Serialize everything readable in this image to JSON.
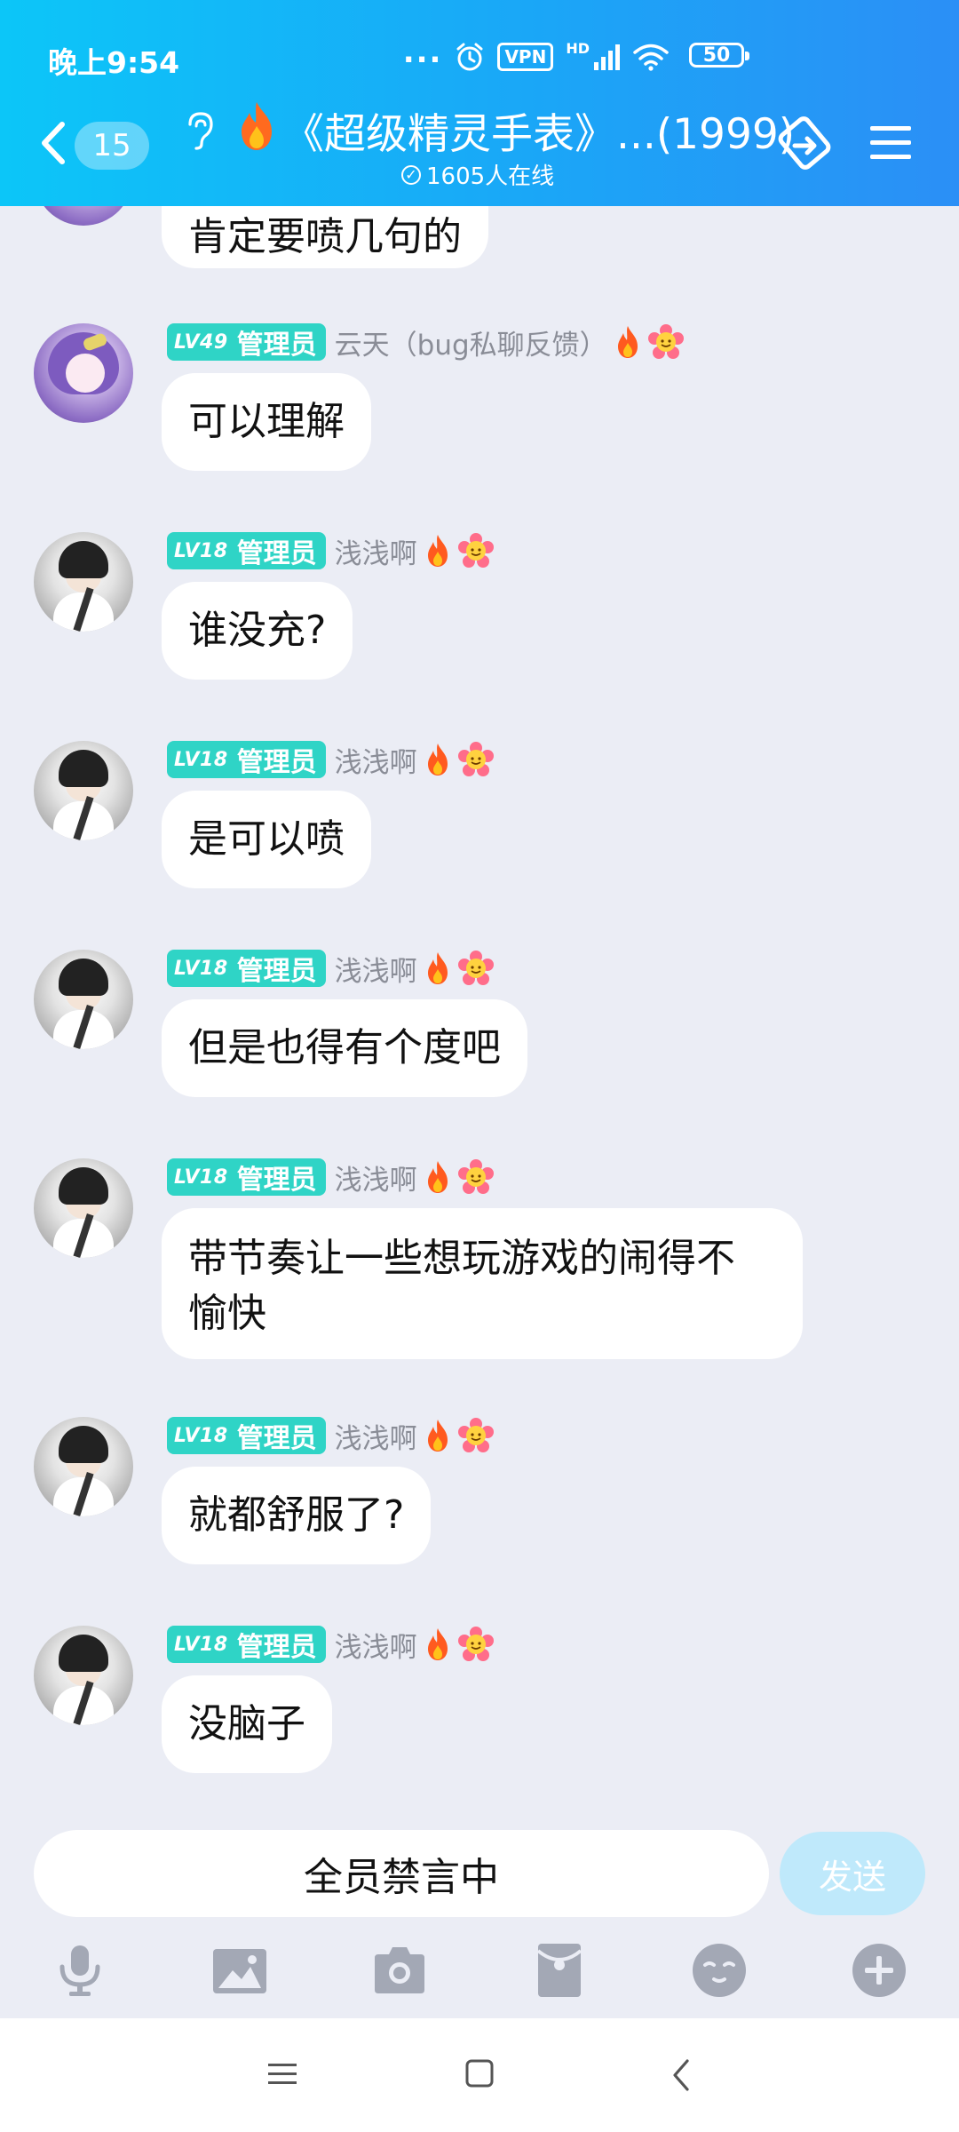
{
  "status_bar": {
    "time": "晚上9:54",
    "dots": "...",
    "vpn": "VPN",
    "hd": "HD",
    "battery": "50"
  },
  "header": {
    "unread_count": "15",
    "title": "《超级精灵手表》...(1999)",
    "online_text": "1605人在线",
    "colors": {
      "gradient_start": "#0cc6f8",
      "gradient_end": "#2b8ff6"
    }
  },
  "messages": [
    {
      "text": "肯定要喷几句的"
    },
    {
      "level": "LV49",
      "role": "管理员",
      "sender": "云天（bug私聊反馈）",
      "text": "可以理解"
    },
    {
      "level": "LV18",
      "role": "管理员",
      "sender": "浅浅啊",
      "text": "谁没充?"
    },
    {
      "level": "LV18",
      "role": "管理员",
      "sender": "浅浅啊",
      "text": "是可以喷"
    },
    {
      "level": "LV18",
      "role": "管理员",
      "sender": "浅浅啊",
      "text": "但是也得有个度吧"
    },
    {
      "level": "LV18",
      "role": "管理员",
      "sender": "浅浅啊",
      "text_line1": "带节奏让一些想玩游戏的闹得不",
      "text_line2": "愉快"
    },
    {
      "level": "LV18",
      "role": "管理员",
      "sender": "浅浅啊",
      "text": "就都舒服了?"
    },
    {
      "level": "LV18",
      "role": "管理员",
      "sender": "浅浅啊",
      "text": "没脑子"
    }
  ],
  "input": {
    "muted_text": "全员禁言中",
    "send_label": "发送"
  },
  "toolbar_icons": [
    "microphone-icon",
    "image-icon",
    "camera-icon",
    "red-packet-icon",
    "emoji-icon",
    "plus-icon"
  ],
  "badge_color": "#2fd4c6"
}
